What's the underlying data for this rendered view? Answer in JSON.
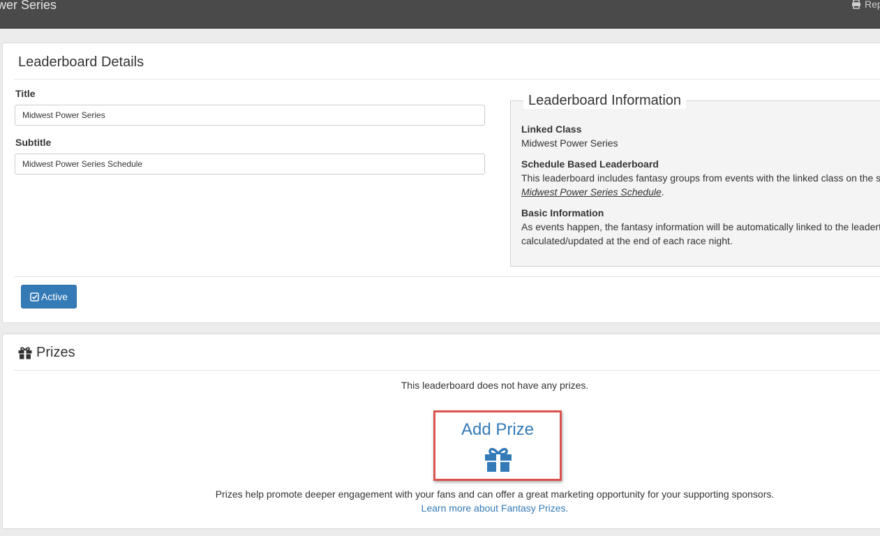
{
  "topbar": {
    "title": "ower Series",
    "report_label": "Rep"
  },
  "details": {
    "heading": "Leaderboard Details",
    "title_label": "Title",
    "title_value": "Midwest Power Series",
    "subtitle_label": "Subtitle",
    "subtitle_value": "Midwest Power Series Schedule",
    "active_button": "Active"
  },
  "info": {
    "legend": "Leaderboard Information",
    "linked_class_title": "Linked Class",
    "linked_class_value": "Midwest Power Series",
    "schedule_title": "Schedule Based Leaderboard",
    "schedule_text": "This leaderboard includes fantasy groups from events with the linked class on the s",
    "schedule_link": "Midwest Power Series Schedule",
    "schedule_suffix": ".",
    "basic_title": "Basic Information",
    "basic_text_1": "As events happen, the fantasy information will be automatically linked to the leadert",
    "basic_text_2": "calculated/updated at the end of each race night."
  },
  "prizes": {
    "heading": "Prizes",
    "empty_text": "This leaderboard does not have any prizes.",
    "add_prize_label": "Add Prize",
    "promo_text": "Prizes help promote deeper engagement with your fans and can offer a great marketing opportunity for your supporting sponsors.",
    "learn_more": "Learn more about Fantasy Prizes."
  },
  "colors": {
    "primary": "#337ab7",
    "highlight_border": "#d9534f",
    "topbar": "#4a4a4a"
  },
  "icons": [
    "print-icon",
    "check-square-icon",
    "gift-icon"
  ]
}
